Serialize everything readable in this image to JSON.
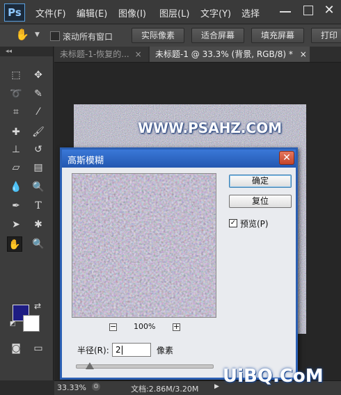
{
  "app": {
    "logo": "Ps"
  },
  "menubar": {
    "items": [
      "文件(F)",
      "编辑(E)",
      "图像(I)",
      "图层(L)",
      "文字(Y)",
      "选择"
    ]
  },
  "options": {
    "scroll_all_label": "滚动所有窗口",
    "buttons": [
      "实际像素",
      "适合屏幕",
      "填充屏幕",
      "打印"
    ]
  },
  "tabs": [
    {
      "label": "未标题-1-恢复的...",
      "close": "×"
    },
    {
      "label": "未标题-1 @ 33.3% (背景, RGB/8) *",
      "close": "×"
    }
  ],
  "toolbox": {
    "header": "◂◂"
  },
  "canvas": {
    "watermark": "WWW.PSAHZ.COM"
  },
  "dialog": {
    "title": "高斯模糊",
    "close": "✕",
    "ok_label": "确定",
    "reset_label": "复位",
    "preview_checked": true,
    "preview_label": "预览(P)",
    "zoom_out": "−",
    "zoom_level": "100%",
    "zoom_in": "+",
    "radius_label": "半径(R):",
    "radius_value": "2",
    "radius_unit": "像素"
  },
  "statusbar": {
    "zoom": "33.33%",
    "doc_info": "文档:2.86M/3.20M"
  },
  "site_logo": "UiBQ.CoM",
  "colors": {
    "foreground": "#1e1d83",
    "background": "#ffffff",
    "accent": "#2b5fb3"
  }
}
